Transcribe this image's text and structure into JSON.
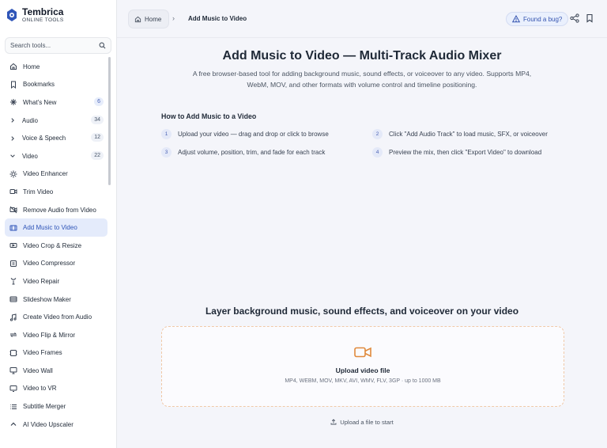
{
  "brand": {
    "name": "Tembrica",
    "subtitle": "ONLINE TOOLS"
  },
  "search": {
    "placeholder": "Search tools..."
  },
  "sidebar": {
    "items": [
      {
        "label": "Home",
        "icon": "home-icon"
      },
      {
        "label": "Bookmarks",
        "icon": "bookmark-icon"
      },
      {
        "label": "What's New",
        "icon": "sparkle-icon",
        "badge": "6"
      },
      {
        "label": "Audio",
        "icon": "chevron-right-icon",
        "badge": "34"
      },
      {
        "label": "Voice & Speech",
        "icon": "chevron-right-icon",
        "badge": "12"
      },
      {
        "label": "Video",
        "icon": "chevron-down-icon",
        "badge": "22"
      },
      {
        "label": "Video Enhancer",
        "icon": "sun-icon"
      },
      {
        "label": "Trim Video",
        "icon": "video-camera-icon"
      },
      {
        "label": "Remove Audio from Video",
        "icon": "video-off-icon"
      },
      {
        "label": "Add Music to Video",
        "icon": "film-music-icon",
        "active": true
      },
      {
        "label": "Video Crop & Resize",
        "icon": "crop-icon"
      },
      {
        "label": "Video Compressor",
        "icon": "compress-icon"
      },
      {
        "label": "Video Repair",
        "icon": "wrench-icon"
      },
      {
        "label": "Slideshow Maker",
        "icon": "slides-icon"
      },
      {
        "label": "Create Video from Audio",
        "icon": "music-note-icon"
      },
      {
        "label": "Video Flip & Mirror",
        "icon": "flip-icon"
      },
      {
        "label": "Video Frames",
        "icon": "frames-icon"
      },
      {
        "label": "Video Wall",
        "icon": "monitor-icon"
      },
      {
        "label": "Video to VR",
        "icon": "vr-icon"
      },
      {
        "label": "Subtitle Merger",
        "icon": "list-icon"
      },
      {
        "label": "AI Video Upscaler",
        "icon": "chevron-up-icon"
      }
    ]
  },
  "breadcrumb": {
    "home": "Home",
    "separator": "›",
    "current": "Add Music to Video"
  },
  "header": {
    "bug_label": "Found a bug?"
  },
  "page": {
    "title": "Add Music to Video — Multi-Track Audio Mixer",
    "description_line1": "A free browser-based tool for adding background music, sound effects, or voiceover to any video. Supports MP4,",
    "description_line2": "WebM, MOV, and other formats with volume control and timeline positioning."
  },
  "howto": {
    "title": "How to Add Music to a Video",
    "steps": [
      {
        "num": "1",
        "text": "Upload your video — drag and drop or click to browse"
      },
      {
        "num": "2",
        "text": "Click \"Add Audio Track\" to load music, SFX, or voiceover"
      },
      {
        "num": "3",
        "text": "Adjust volume, position, trim, and fade for each track"
      },
      {
        "num": "4",
        "text": "Preview the mix, then click \"Export Video\" to download"
      }
    ]
  },
  "upload": {
    "heading": "Layer background music, sound effects, and voiceover on your video",
    "title": "Upload video file",
    "formats": "MP4, WEBM, MOV, MKV, AVI, WMV, FLV, 3GP · up to 1000 MB",
    "hint": "Upload a file to start"
  },
  "colors": {
    "accent": "#2f55b8",
    "active_bg": "#e4ebfb",
    "dropzone_border": "#f0c9a8",
    "upload_icon": "#e08a3c"
  }
}
